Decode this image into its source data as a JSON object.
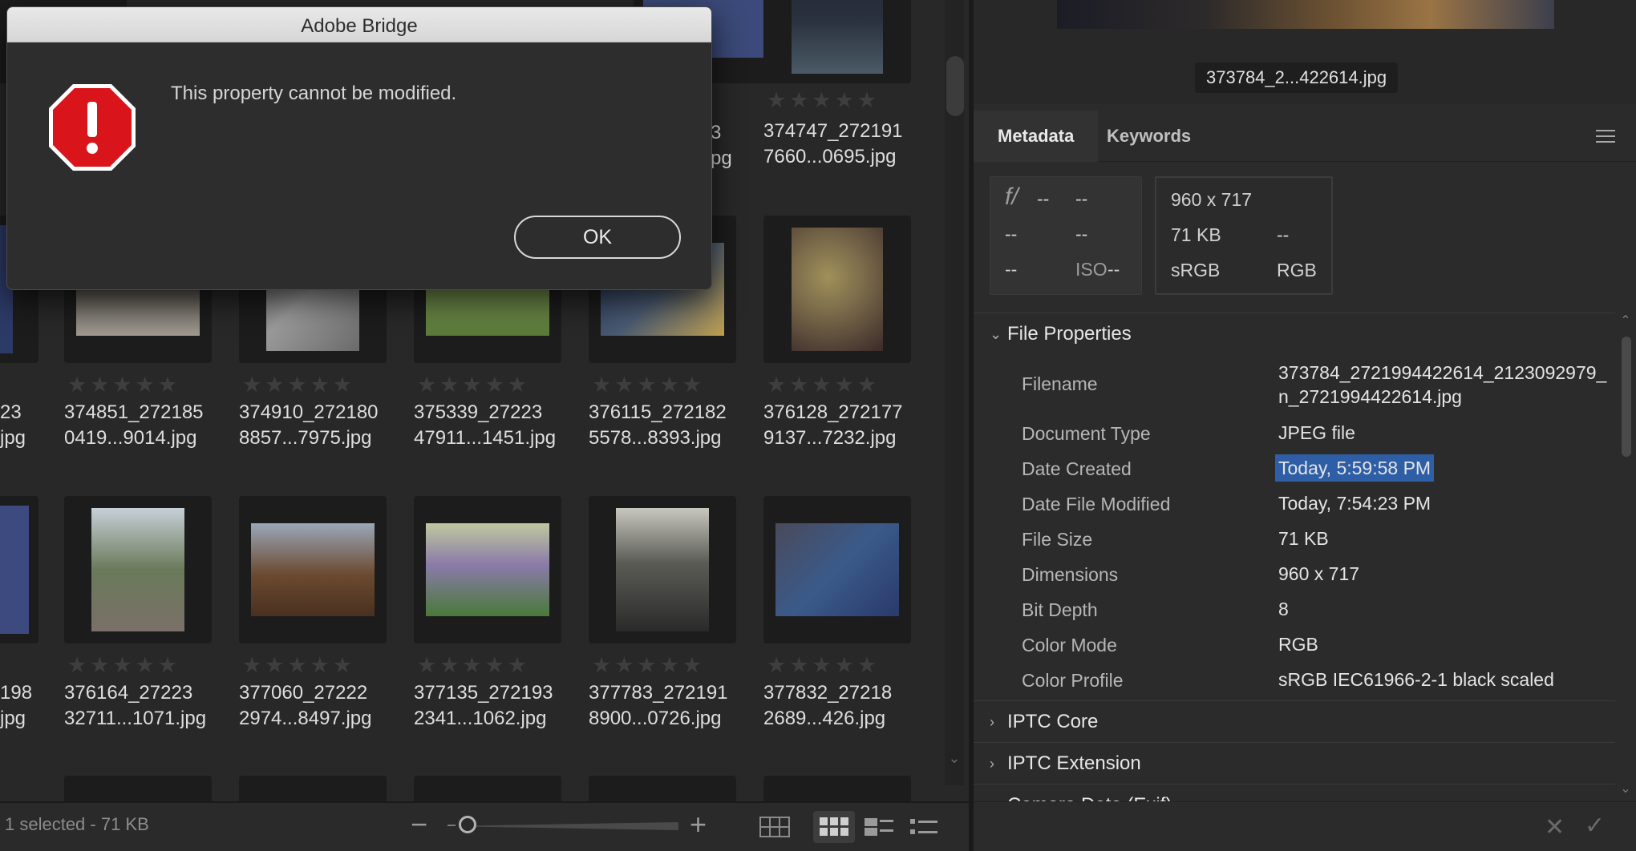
{
  "dialog": {
    "title": "Adobe Bridge",
    "message": "This property cannot be modified.",
    "ok_label": "OK"
  },
  "content": {
    "rows": [
      [
        {
          "name1": "3",
          "name2": "pg",
          "thumb": "#3b4a7a",
          "partial": true
        },
        {
          "name1": "374747_272191",
          "name2": "7660...0695.jpg",
          "thumb": "#2b3340"
        }
      ],
      [
        {
          "name1": "23",
          "name2": "jpg",
          "thumb": "#2c3a66",
          "partial": true
        },
        {
          "name1": "374851_272185",
          "name2": "0419...9014.jpg",
          "thumb": "#5a5650"
        },
        {
          "name1": "374910_272180",
          "name2": "8857...7975.jpg",
          "thumb": "#8a8a8a"
        },
        {
          "name1": "375339_27223",
          "name2": "47911...1451.jpg",
          "thumb": "#6f8a4a"
        },
        {
          "name1": "376115_272182",
          "name2": "5578...8393.jpg",
          "thumb": "#4a5a72"
        },
        {
          "name1": "376128_272177",
          "name2": "9137...7232.jpg",
          "thumb": "#7a6a4a"
        }
      ],
      [
        {
          "name1": "198",
          "name2": "jpg",
          "thumb": "#3c4a80",
          "partial": true
        },
        {
          "name1": "376164_27223",
          "name2": "32711...1071.jpg",
          "thumb": "#6a7a5a"
        },
        {
          "name1": "377060_27222",
          "name2": "2974...8497.jpg",
          "thumb": "#6b4a30"
        },
        {
          "name1": "377135_272193",
          "name2": "2341...1062.jpg",
          "thumb": "#8a7aa8"
        },
        {
          "name1": "377783_272191",
          "name2": "8900...0726.jpg",
          "thumb": "#5a5a55"
        },
        {
          "name1": "377832_27218",
          "name2": "2689...426.jpg",
          "thumb": "#3a5a8a"
        }
      ]
    ]
  },
  "status": {
    "text": "1 selected - 71 KB",
    "zoom_level": 0.05
  },
  "preview": {
    "filename": "373784_2...422614.jpg"
  },
  "panel": {
    "tabs": [
      "Metadata",
      "Keywords"
    ],
    "placard": {
      "aperture_icon": "f/",
      "aperture": "--",
      "shutter": "--",
      "c1": "--",
      "c2": "--",
      "c3": "--",
      "iso_label": "ISO",
      "iso": "--",
      "dimensions": "960 x 717",
      "size": "71 KB",
      "size2": "--",
      "profile": "sRGB",
      "mode": "RGB"
    },
    "sections": {
      "file_properties": "File Properties",
      "iptc_core": "IPTC Core",
      "iptc_ext": "IPTC Extension",
      "camera_data": "Camera Data (Exif)"
    },
    "fields": [
      {
        "key": "Filename",
        "value": "373784_2721994422614_2123092979_n_2721994422614.jpg"
      },
      {
        "key": "Document Type",
        "value": "JPEG file"
      },
      {
        "key": "Date Created",
        "value": "Today, 5:59:58 PM"
      },
      {
        "key": "Date File Modified",
        "value": "Today, 7:54:23 PM"
      },
      {
        "key": "File Size",
        "value": "71 KB"
      },
      {
        "key": "Dimensions",
        "value": "960 x 717"
      },
      {
        "key": "Bit Depth",
        "value": "8"
      },
      {
        "key": "Color Mode",
        "value": "RGB"
      },
      {
        "key": "Color Profile",
        "value": "sRGB IEC61966-2-1 black scaled"
      }
    ]
  },
  "icons": {
    "alert": "alert-stop-icon",
    "menu": "hamburger-menu-icon",
    "cancel": "x-icon",
    "apply": "checkmark-icon"
  },
  "colors": {
    "accent_selection": "#2e5fa6",
    "alert_red": "#d9141b"
  }
}
